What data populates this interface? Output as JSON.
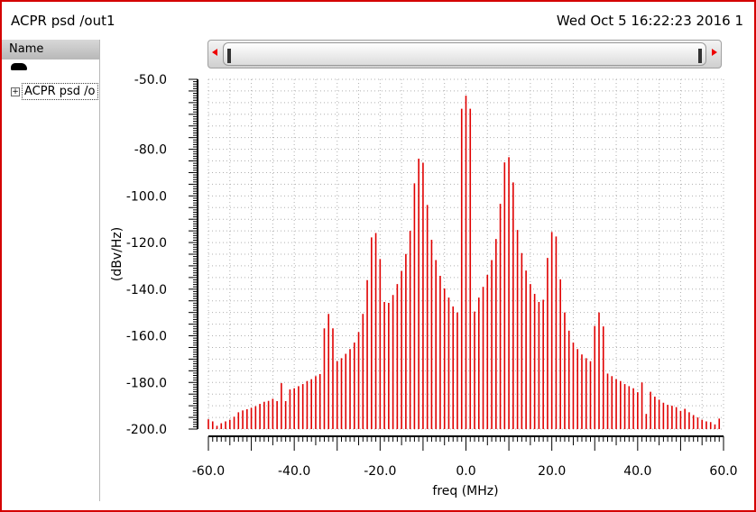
{
  "window": {
    "title": "ACPR psd /out1",
    "timestamp": "Wed Oct 5 16:22:23 2016  1"
  },
  "browser": {
    "header": "Name",
    "items": [
      {
        "label": "ACPR psd /o",
        "expand": "+"
      }
    ]
  },
  "colors": {
    "trace": "#e00000",
    "frame": "#d40000",
    "grid": "#b0b0b0"
  },
  "chart_data": {
    "type": "bar",
    "xlabel": "freq (MHz)",
    "ylabel": "(dBv/Hz)",
    "xlim": [
      -60,
      60
    ],
    "ylim": [
      -200,
      -50
    ],
    "grid": true,
    "x_tick_labels": [
      "-60.0",
      "-40.0",
      "-20.0",
      "0.0",
      "20.0",
      "40.0",
      "60.0"
    ],
    "x_ticks": [
      -60,
      -40,
      -20,
      0,
      20,
      40,
      60
    ],
    "y_tick_labels": [
      "-50.0",
      "-80.0",
      "-100.0",
      "-120.0",
      "-140.0",
      "-160.0",
      "-180.0",
      "-200.0"
    ],
    "y_ticks": [
      -50,
      -80,
      -100,
      -120,
      -140,
      -160,
      -180,
      -200
    ],
    "x_start": -60,
    "x_step": 1,
    "values": [
      -195.8,
      -196.7,
      -198.6,
      -197.5,
      -196.7,
      -196,
      -194.7,
      -192.8,
      -192,
      -191.5,
      -190.9,
      -190.2,
      -189.2,
      -188.3,
      -187.9,
      -187,
      -188,
      -180.3,
      -188,
      -183,
      -182.5,
      -181.6,
      -180.7,
      -179.4,
      -178.6,
      -177.3,
      -176.4,
      -156.8,
      -150.6,
      -156.8,
      -170.9,
      -169.6,
      -167.7,
      -165.7,
      -162.9,
      -158.4,
      -150.6,
      -136.1,
      -117.8,
      -115.9,
      -127.1,
      -145.5,
      -145.9,
      -142.5,
      -137.8,
      -132.2,
      -124.9,
      -115,
      -94.6,
      -84,
      -85.8,
      -103.9,
      -118.8,
      -127.5,
      -134.3,
      -139.7,
      -143.6,
      -147.4,
      -150,
      -62.6,
      -57,
      -62.6,
      -149.6,
      -143.6,
      -139,
      -133.9,
      -127.5,
      -118.5,
      -103.4,
      -85.6,
      -83.4,
      -94.2,
      -114.6,
      -124.5,
      -132,
      -137.8,
      -142,
      -145.5,
      -144.5,
      -126.6,
      -115.5,
      -117.4,
      -135.8,
      -150,
      -157.8,
      -162.9,
      -165.7,
      -168,
      -169.6,
      -170.9,
      -155.8,
      -150,
      -156,
      -176.2,
      -177.3,
      -178.6,
      -179.4,
      -180.7,
      -181.6,
      -182.5,
      -184.2,
      -180,
      -193.5,
      -184,
      -186.1,
      -187.4,
      -188.7,
      -189.6,
      -190,
      -190.6,
      -192.2,
      -191.3,
      -192.8,
      -194,
      -195,
      -196,
      -196.7,
      -197,
      -198,
      -195.5
    ]
  }
}
